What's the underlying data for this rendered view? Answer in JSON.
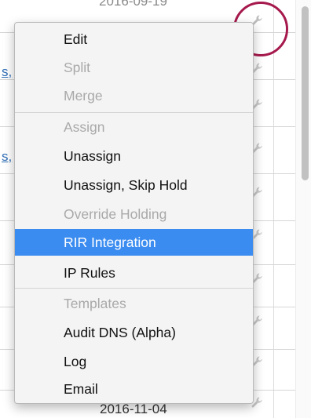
{
  "table": {
    "link_fragment": "s,",
    "date_top": "2016-09-19",
    "date_bottom": "2016-11-04"
  },
  "context_menu": {
    "items": [
      {
        "label": "Edit",
        "enabled": true
      },
      {
        "label": "Split",
        "enabled": false
      },
      {
        "label": "Merge",
        "enabled": false
      },
      {
        "label": "Assign",
        "enabled": false
      },
      {
        "label": "Unassign",
        "enabled": true
      },
      {
        "label": "Unassign, Skip Hold",
        "enabled": true
      },
      {
        "label": "Override Holding",
        "enabled": false
      },
      {
        "label": "RIR Integration",
        "enabled": true,
        "selected": true
      },
      {
        "label": "IP Rules",
        "enabled": true
      },
      {
        "label": "Templates",
        "enabled": false
      },
      {
        "label": "Audit DNS (Alpha)",
        "enabled": true
      },
      {
        "label": "Log",
        "enabled": true
      },
      {
        "label": "Email",
        "enabled": true
      }
    ],
    "selected_color": "#3b8cf0",
    "disabled_color": "#a9a9a9"
  },
  "icons": {
    "row_action": "wrench-icon"
  },
  "annotation": {
    "circle_color": "#a6194c"
  }
}
